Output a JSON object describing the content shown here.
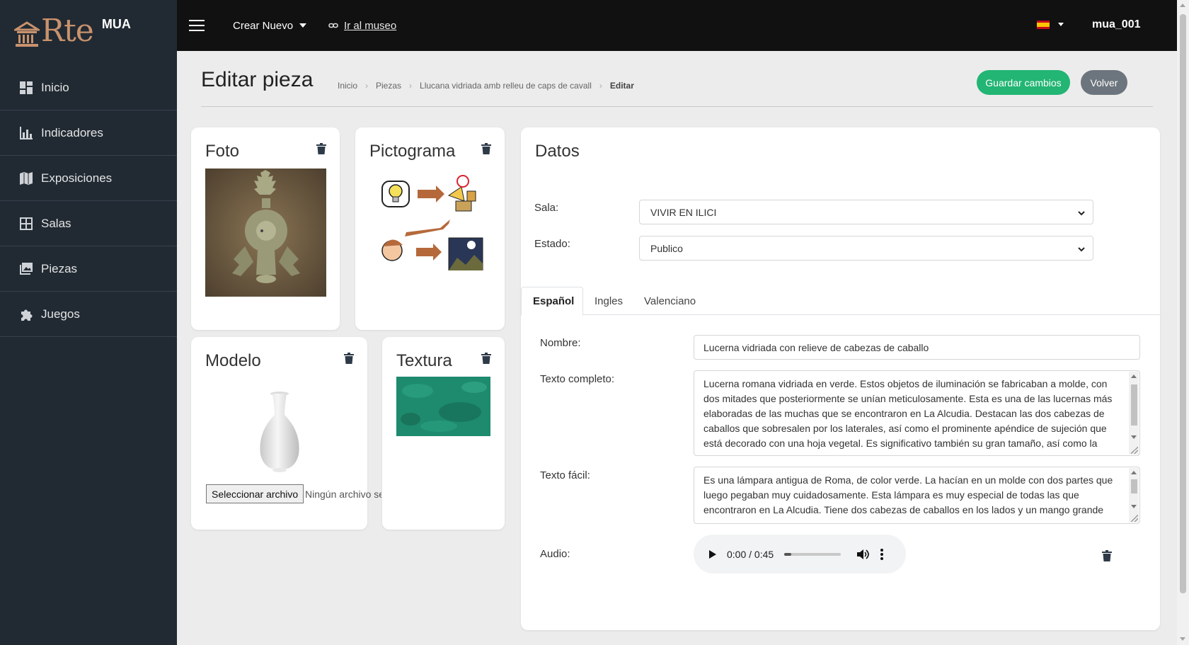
{
  "brand": {
    "logo_text": "Rte",
    "app_name": "MUA",
    "brand_color": "#c9926d"
  },
  "sidebar": {
    "items": [
      {
        "label": "Inicio",
        "icon": "dashboard-icon"
      },
      {
        "label": "Indicadores",
        "icon": "bar-chart-icon"
      },
      {
        "label": "Exposiciones",
        "icon": "map-icon"
      },
      {
        "label": "Salas",
        "icon": "grid-icon"
      },
      {
        "label": "Piezas",
        "icon": "images-icon"
      },
      {
        "label": "Juegos",
        "icon": "puzzle-icon"
      }
    ]
  },
  "topbar": {
    "create_label": "Crear Nuevo",
    "museum_link": "Ir al museo",
    "language_flag": "spain-flag-icon",
    "username": "mua_001"
  },
  "page": {
    "title": "Editar pieza",
    "breadcrumbs": [
      "Inicio",
      "Piezas",
      "Llucana vidriada amb relleu de caps de cavall",
      "Editar"
    ],
    "save_label": "Guardar cambios",
    "back_label": "Volver"
  },
  "media": {
    "foto_title": "Foto",
    "pictograma_title": "Pictograma",
    "modelo_title": "Modelo",
    "textura_title": "Textura",
    "file_button": "Seleccionar archivo",
    "file_status": "Ningún archivo se"
  },
  "datos": {
    "title": "Datos",
    "sala_label": "Sala:",
    "sala_value": "VIVIR EN ILICI",
    "estado_label": "Estado:",
    "estado_value": "Publico",
    "tabs": [
      "Español",
      "Ingles",
      "Valenciano"
    ],
    "nombre_label": "Nombre:",
    "nombre_value": "Lucerna vidriada con relieve de cabezas de caballo",
    "texto_completo_label": "Texto completo:",
    "texto_completo_value": "Lucerna romana vidriada en verde. Estos objetos de iluminación se fabricaban a molde, con dos mitades que posteriormente se unían meticulosamente. Esta es una de las lucernas más elaboradas de las muchas que se encontraron en La Alcudia. Destacan las dos cabezas de caballos que sobresalen por los laterales, así como el prominente apéndice de sujeción que está decorado con una hoja vegetal. Es significativo también su gran tamaño, así como la",
    "texto_facil_label": "Texto fácil:",
    "texto_facil_value": "Es una lámpara antigua de Roma, de color verde. La hacían en un molde con dos partes que luego pegaban muy cuidadosamente. Esta lámpara es muy especial de todas las que encontraron en La Alcudia. Tiene dos cabezas de caballos en los lados y un mango grande",
    "audio_label": "Audio:",
    "audio_time": "0:00 / 0:45",
    "audio_progress": 0.05
  },
  "colors": {
    "save": "#22b573",
    "back": "#6c757d",
    "sidebar": "#212a33",
    "topbar": "#111111"
  }
}
